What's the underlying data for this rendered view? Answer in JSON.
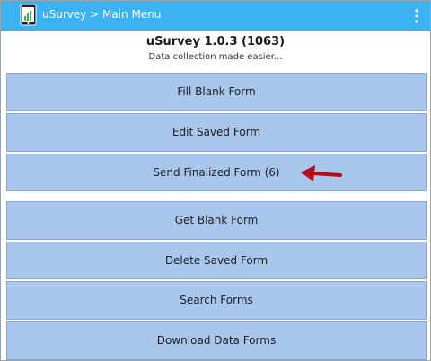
{
  "app_bar": {
    "title": "uSurvey > Main Menu",
    "app_icon": "phone-chart-icon",
    "menu_icon": "overflow-menu-icon",
    "color": "#3cb2f3"
  },
  "header": {
    "version": "uSurvey 1.0.3 (1063)",
    "tagline": "Data collection made easier..."
  },
  "menu": {
    "button_color": "#a9c6ec",
    "items": [
      {
        "label": "Fill Blank Form"
      },
      {
        "label": "Edit Saved Form"
      },
      {
        "label": "Send Finalized Form (6)"
      },
      {
        "label": "Get Blank Form"
      },
      {
        "label": "Delete Saved Form"
      },
      {
        "label": "Search Forms"
      },
      {
        "label": "Download Data Forms"
      }
    ]
  },
  "annotation": {
    "icon": "red-arrow-icon",
    "color": "#b30e17"
  }
}
